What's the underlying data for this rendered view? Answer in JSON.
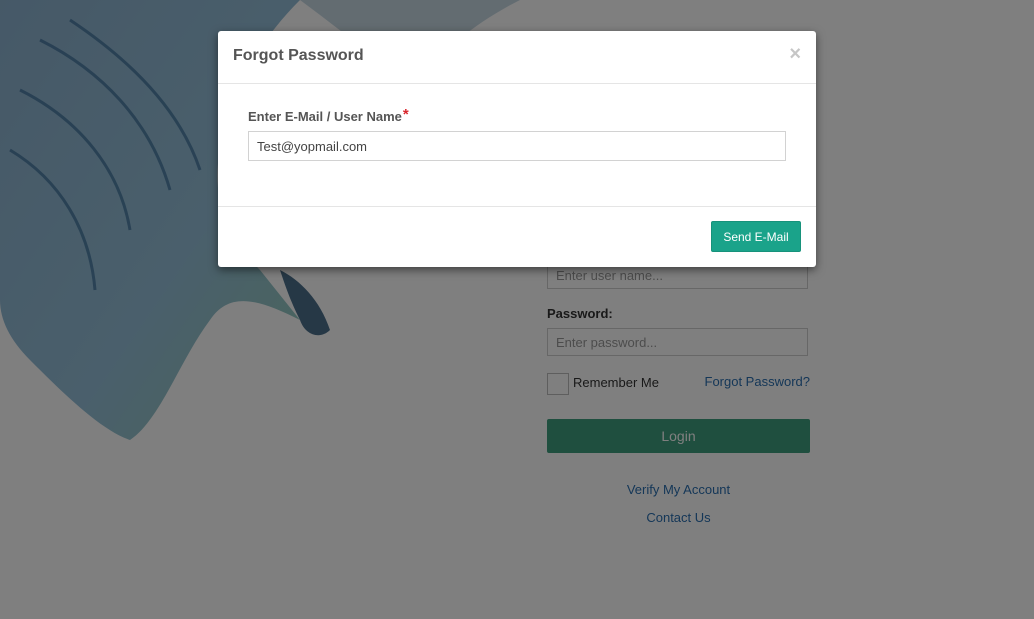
{
  "login": {
    "username_placeholder": "Enter user name...",
    "password_label": "Password:",
    "password_placeholder": "Enter password...",
    "remember_label": "Remember Me",
    "forgot_link": "Forgot Password?",
    "login_button": "Login",
    "verify_link": "Verify My Account",
    "contact_link": "Contact Us"
  },
  "modal": {
    "title": "Forgot Password",
    "close_symbol": "×",
    "field_label": "Enter E-Mail / User Name",
    "required_mark": "*",
    "field_value": "Test@yopmail.com",
    "send_button": "Send E-Mail"
  },
  "colors": {
    "accent": "#1aa38a",
    "login_button": "#3f9e7e",
    "link": "#2a6fb0",
    "required": "#d9262c"
  }
}
